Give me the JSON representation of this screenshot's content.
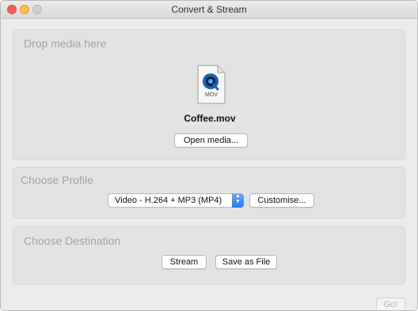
{
  "window": {
    "title": "Convert & Stream"
  },
  "drop_panel": {
    "heading": "Drop media here",
    "file_icon_label": "MOV",
    "file_name": "Coffee.mov",
    "open_button": "Open media..."
  },
  "profile_panel": {
    "heading": "Choose Profile",
    "selected_profile": "Video - H.264 + MP3 (MP4)",
    "customise_button": "Customise..."
  },
  "destination_panel": {
    "heading": "Choose Destination",
    "stream_button": "Stream",
    "save_button": "Save as File"
  },
  "footer": {
    "go_button": "Go!"
  },
  "colors": {
    "accent": "#2c79ea",
    "close": "#fc605c",
    "minimize": "#fdbc40"
  }
}
